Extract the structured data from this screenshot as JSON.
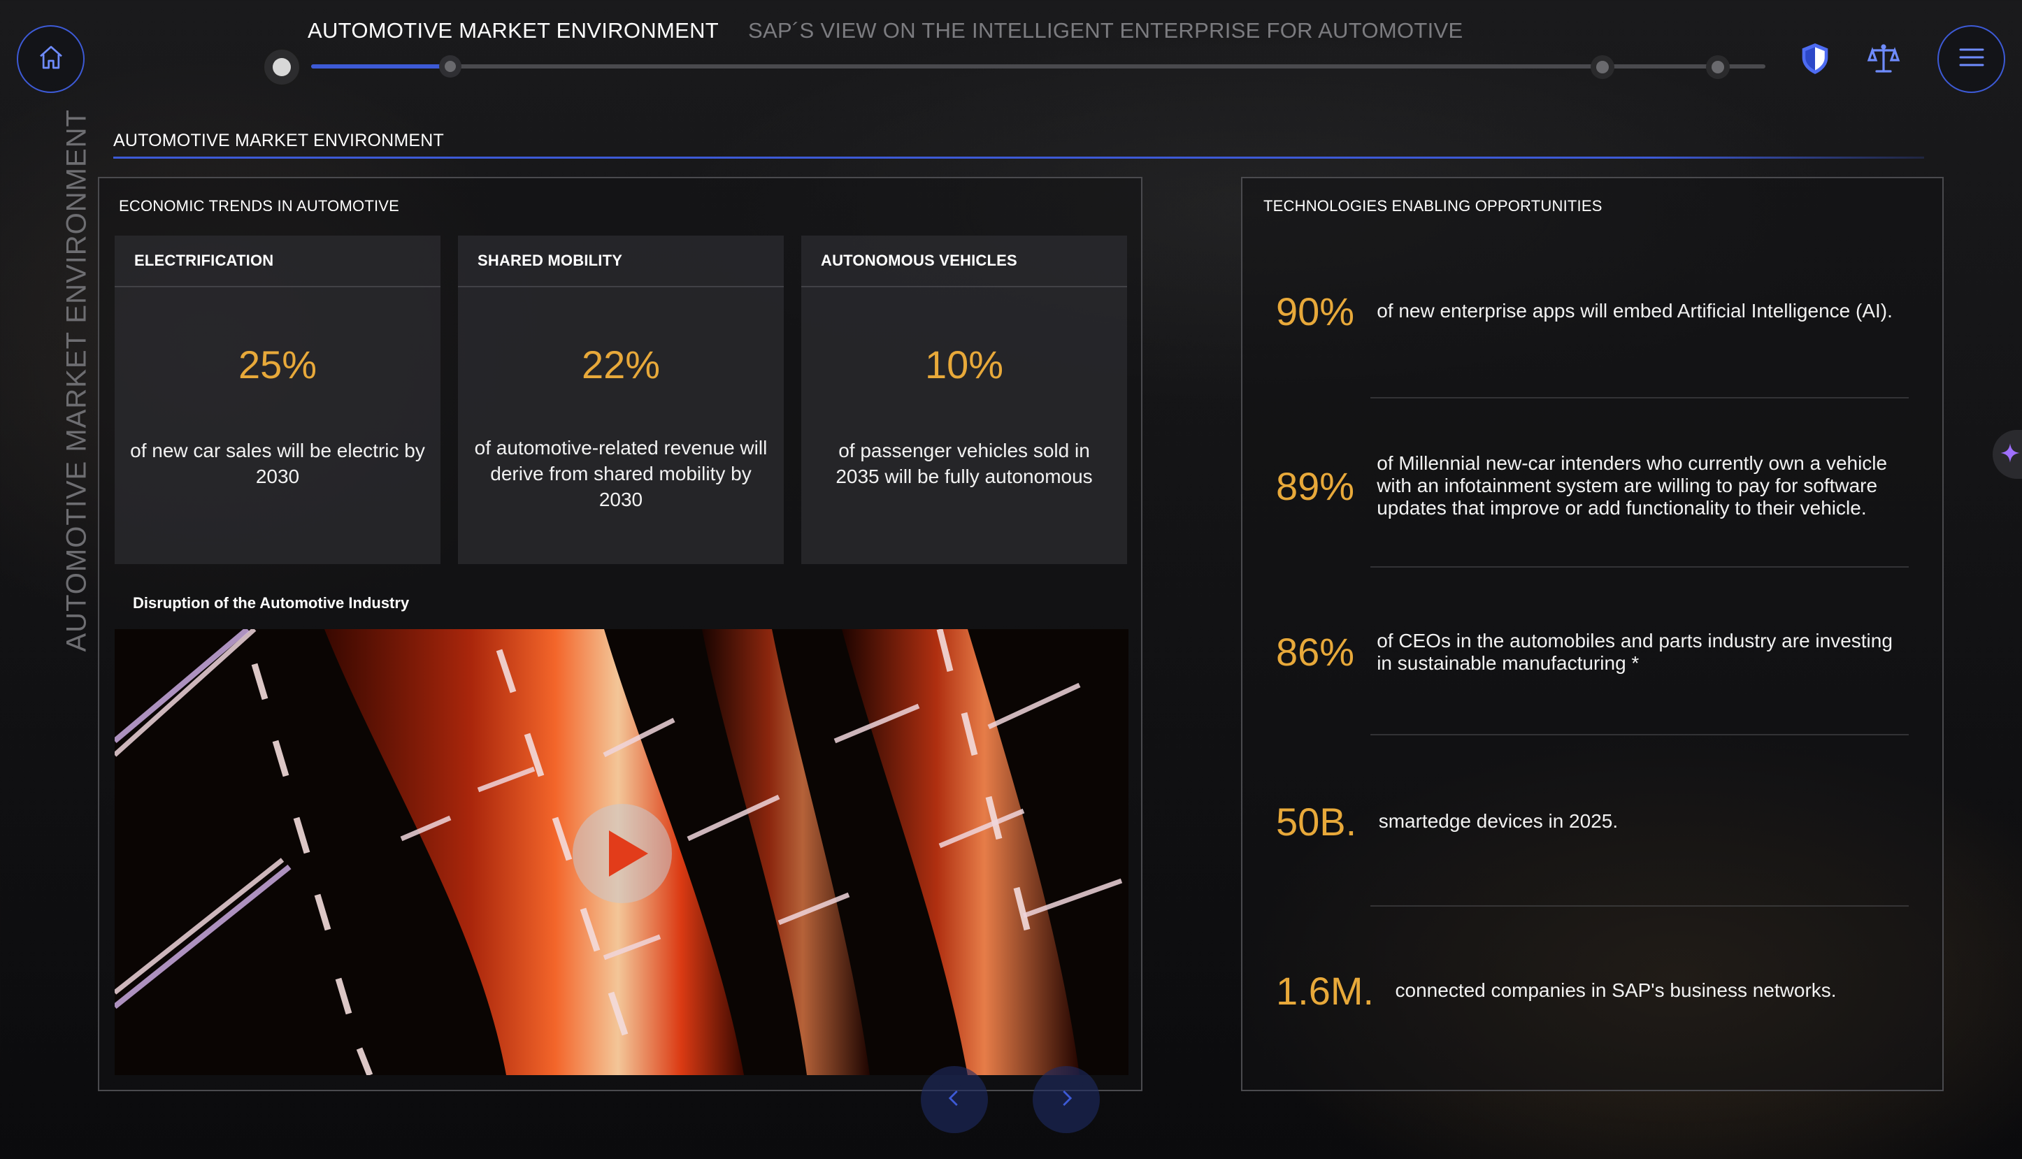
{
  "header": {
    "nav_current": "AUTOMOTIVE MARKET ENVIRONMENT",
    "nav_next": "SAP´S VIEW ON THE INTELLIGENT ENTERPRISE FOR AUTOMOTIVE",
    "progress_fraction": 0.09
  },
  "page": {
    "section_title": "AUTOMOTIVE MARKET ENVIRONMENT",
    "vertical_title": "AUTOMOTIVE MARKET ENVIRONMENT"
  },
  "left_panel": {
    "title": "ECONOMIC TRENDS IN AUTOMOTIVE",
    "cards": [
      {
        "title": "ELECTRIFICATION",
        "value": "25%",
        "text": "of new car sales will be electric by 2030"
      },
      {
        "title": "SHARED MOBILITY",
        "value": "22%",
        "text": "of automotive-related revenue will derive from shared mobility by 2030"
      },
      {
        "title": "AUTONOMOUS VEHICLES",
        "value": "10%",
        "text": "of passenger vehicles sold in 2035 will be fully autonomous"
      }
    ],
    "video_title": "Disruption of the Automotive Industry"
  },
  "right_panel": {
    "title": "TECHNOLOGIES ENABLING OPPORTUNITIES",
    "stats": [
      {
        "value": "90%",
        "text": "of new enterprise apps will embed Artificial Intelligence (AI)."
      },
      {
        "value": "89%",
        "text": "of Millennial new-car intenders who currently own a vehicle with an infotainment system are willing to pay for software updates that improve or add functionality to their vehicle."
      },
      {
        "value": "86%",
        "text": "of CEOs in the automobiles and parts industry are investing in sustainable manufacturing *"
      },
      {
        "value": "50B.",
        "text": "smartedge devices in 2025."
      },
      {
        "value": "1.6M.",
        "text": "connected companies in SAP's business networks."
      }
    ]
  },
  "icons": {
    "home": "home-icon",
    "shield": "shield-icon",
    "scales": "scales-icon",
    "menu": "menu-icon",
    "play": "play-icon",
    "prev": "chevron-left-icon",
    "next": "chevron-right-icon",
    "sparkle": "sparkle-icon"
  },
  "colors": {
    "accent_blue": "#3d5ad6",
    "accent_gold": "#e8a93a"
  }
}
